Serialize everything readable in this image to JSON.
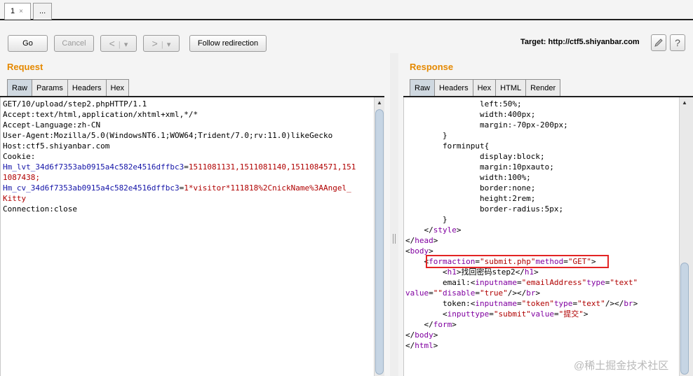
{
  "tabs": [
    {
      "label": "1",
      "close": "×"
    },
    {
      "label": "..."
    }
  ],
  "toolbar": {
    "go": "Go",
    "cancel": "Cancel",
    "back": "<",
    "forward": ">",
    "dropdown": "▾",
    "follow": "Follow redirection",
    "target_label": "Target: http://ctf5.shiyanbar.com",
    "edit_icon": "pencil-icon",
    "help": "?"
  },
  "request": {
    "title": "Request",
    "tabs": [
      "Raw",
      "Params",
      "Headers",
      "Hex"
    ],
    "active_tab": "Raw",
    "lines": [
      [
        {
          "t": "GET/10/upload/step2.phpHTTP/1.1",
          "c": "pl"
        }
      ],
      [
        {
          "t": "Accept:text/html,application/xhtml+xml,*/*",
          "c": "pl"
        }
      ],
      [
        {
          "t": "Accept-Language:zh-CN",
          "c": "pl"
        }
      ],
      [
        {
          "t": "User-Agent:Mozilla/5.0(WindowsNT6.1;WOW64;Trident/7.0;rv:11.0)likeGecko",
          "c": "pl"
        }
      ],
      [
        {
          "t": "Host:ctf5.shiyanbar.com",
          "c": "pl"
        }
      ],
      [
        {
          "t": "Cookie:",
          "c": "pl"
        }
      ],
      [
        {
          "t": "Hm_lvt_34d6f7353ab0915a4c582e4516dffbc3",
          "c": "kw"
        },
        {
          "t": "=",
          "c": "pl"
        },
        {
          "t": "1511081131,1511081140,1511084571,151",
          "c": "val"
        }
      ],
      [
        {
          "t": "1087438;",
          "c": "val"
        }
      ],
      [
        {
          "t": "Hm_cv_34d6f7353ab0915a4c582e4516dffbc3",
          "c": "kw"
        },
        {
          "t": "=",
          "c": "pl"
        },
        {
          "t": "1*visitor*111818%2CnickName%3AAngel_",
          "c": "val"
        }
      ],
      [
        {
          "t": "Kitty",
          "c": "val"
        }
      ],
      [
        {
          "t": "Connection:close",
          "c": "pl"
        }
      ]
    ]
  },
  "response": {
    "title": "Response",
    "tabs": [
      "Raw",
      "Headers",
      "Hex",
      "HTML",
      "Render"
    ],
    "active_tab": "Raw",
    "lines": [
      [
        {
          "t": "                left:50%;",
          "c": "pl"
        }
      ],
      [
        {
          "t": "                width:400px;",
          "c": "pl"
        }
      ],
      [
        {
          "t": "                margin:-70px-200px;",
          "c": "pl"
        }
      ],
      [
        {
          "t": "        }",
          "c": "pl"
        }
      ],
      [
        {
          "t": "        forminput{",
          "c": "pl"
        }
      ],
      [
        {
          "t": "                display:block;",
          "c": "pl"
        }
      ],
      [
        {
          "t": "                margin:10pxauto;",
          "c": "pl"
        }
      ],
      [
        {
          "t": "                width:100%;",
          "c": "pl"
        }
      ],
      [
        {
          "t": "                border:none;",
          "c": "pl"
        }
      ],
      [
        {
          "t": "                height:2rem;",
          "c": "pl"
        }
      ],
      [
        {
          "t": "                border-radius:5px;",
          "c": "pl"
        }
      ],
      [
        {
          "t": "        }",
          "c": "pl"
        }
      ],
      [
        {
          "t": "    </",
          "c": "pl"
        },
        {
          "t": "style",
          "c": "tag"
        },
        {
          "t": ">",
          "c": "pl"
        }
      ],
      [
        {
          "t": "</",
          "c": "pl"
        },
        {
          "t": "head",
          "c": "tag"
        },
        {
          "t": ">",
          "c": "pl"
        }
      ],
      [
        {
          "t": "<",
          "c": "pl"
        },
        {
          "t": "body",
          "c": "tag"
        },
        {
          "t": ">",
          "c": "pl"
        }
      ],
      [
        {
          "t": "    <",
          "c": "pl"
        },
        {
          "t": "formaction",
          "c": "tag"
        },
        {
          "t": "=",
          "c": "pl"
        },
        {
          "t": "\"submit.php\"",
          "c": "val"
        },
        {
          "t": "method",
          "c": "tag"
        },
        {
          "t": "=",
          "c": "pl"
        },
        {
          "t": "\"GET\"",
          "c": "val"
        },
        {
          "t": ">",
          "c": "pl"
        }
      ],
      [
        {
          "t": "        <",
          "c": "pl"
        },
        {
          "t": "h1",
          "c": "tag"
        },
        {
          "t": ">",
          "c": "pl"
        },
        {
          "t": "找回密码step2",
          "c": "pl"
        },
        {
          "t": "</",
          "c": "pl"
        },
        {
          "t": "h1",
          "c": "tag"
        },
        {
          "t": ">",
          "c": "pl"
        }
      ],
      [
        {
          "t": "        email:<",
          "c": "pl"
        },
        {
          "t": "inputname",
          "c": "tag"
        },
        {
          "t": "=",
          "c": "pl"
        },
        {
          "t": "\"emailAddress\"",
          "c": "val"
        },
        {
          "t": "type",
          "c": "tag"
        },
        {
          "t": "=",
          "c": "pl"
        },
        {
          "t": "\"text\"",
          "c": "val"
        }
      ],
      [
        {
          "t": "value",
          "c": "tag"
        },
        {
          "t": "=",
          "c": "pl"
        },
        {
          "t": "\"\"",
          "c": "val"
        },
        {
          "t": "disable",
          "c": "tag"
        },
        {
          "t": "=",
          "c": "pl"
        },
        {
          "t": "\"true\"",
          "c": "val"
        },
        {
          "t": "/></",
          "c": "pl"
        },
        {
          "t": "br",
          "c": "tag"
        },
        {
          "t": ">",
          "c": "pl"
        }
      ],
      [
        {
          "t": "        token:<",
          "c": "pl"
        },
        {
          "t": "inputname",
          "c": "tag"
        },
        {
          "t": "=",
          "c": "pl"
        },
        {
          "t": "\"token\"",
          "c": "val"
        },
        {
          "t": "type",
          "c": "tag"
        },
        {
          "t": "=",
          "c": "pl"
        },
        {
          "t": "\"text\"",
          "c": "val"
        },
        {
          "t": "/></",
          "c": "pl"
        },
        {
          "t": "br",
          "c": "tag"
        },
        {
          "t": ">",
          "c": "pl"
        }
      ],
      [
        {
          "t": "        <",
          "c": "pl"
        },
        {
          "t": "inputtype",
          "c": "tag"
        },
        {
          "t": "=",
          "c": "pl"
        },
        {
          "t": "\"submit\"",
          "c": "val"
        },
        {
          "t": "value",
          "c": "tag"
        },
        {
          "t": "=",
          "c": "pl"
        },
        {
          "t": "\"提交\"",
          "c": "val"
        },
        {
          "t": ">",
          "c": "pl"
        }
      ],
      [
        {
          "t": "    </",
          "c": "pl"
        },
        {
          "t": "form",
          "c": "tag"
        },
        {
          "t": ">",
          "c": "pl"
        }
      ],
      [
        {
          "t": "</",
          "c": "pl"
        },
        {
          "t": "body",
          "c": "tag"
        },
        {
          "t": ">",
          "c": "pl"
        }
      ],
      [
        {
          "t": "</",
          "c": "pl"
        },
        {
          "t": "html",
          "c": "tag"
        },
        {
          "t": ">",
          "c": "pl"
        }
      ]
    ]
  },
  "watermark": "@稀土掘金技术社区",
  "colors": {
    "accent": "#e58900",
    "highlight": "#e32424"
  }
}
